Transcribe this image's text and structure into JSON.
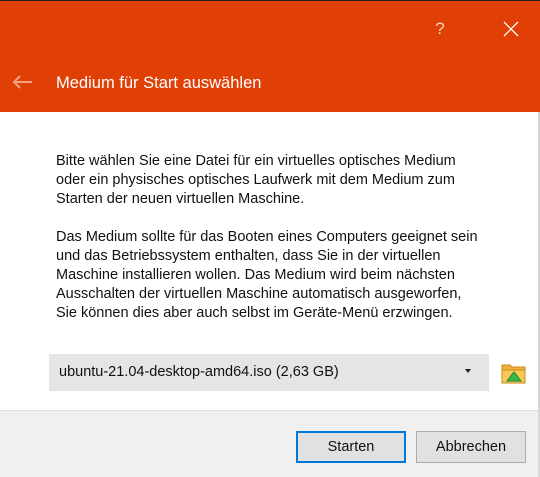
{
  "window": {
    "help_label": "?",
    "title": "Medium für Start auswählen",
    "header_color": "#e04006"
  },
  "body": {
    "paragraph1_lines": [
      "Bitte wählen Sie eine Datei für ein virtuelles optisches Medium",
      "oder ein physisches optisches Laufwerk mit dem Medium zum",
      "Starten der neuen virtuellen Maschine."
    ],
    "paragraph2_lines": [
      "Das Medium sollte für das Booten eines Computers geeignet sein",
      "und das Betriebssystem enthalten, dass Sie in der virtuellen",
      "Maschine installieren wollen. Das Medium wird beim nächsten",
      "Ausschalten der virtuellen Maschine automatisch ausgeworfen,",
      "Sie können dies aber auch selbst im Geräte-Menü erzwingen."
    ]
  },
  "medium_select": {
    "selected_value": "ubuntu-21.04-desktop-amd64.iso (2,63 GB)"
  },
  "icons": {
    "back": "arrow-left-icon",
    "close": "close-icon",
    "folder": "folder-icon",
    "dropdown": "chevron-down-icon"
  },
  "buttons": {
    "start_label": "Starten",
    "cancel_label": "Abbrechen",
    "default_border": "#0078d7"
  }
}
